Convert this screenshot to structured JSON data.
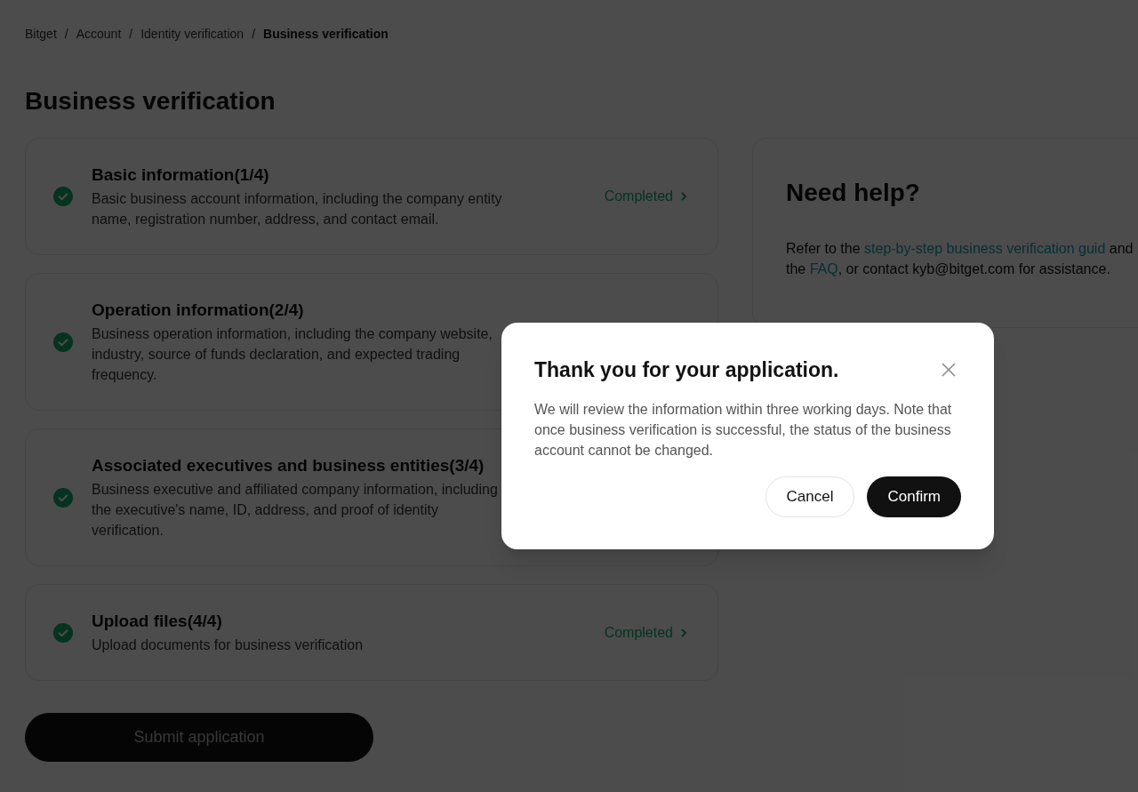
{
  "breadcrumb": [
    {
      "label": "Bitget",
      "current": false
    },
    {
      "label": "Account",
      "current": false
    },
    {
      "label": "Identity verification",
      "current": false
    },
    {
      "label": "Business verification",
      "current": true
    }
  ],
  "breadcrumb_separator": "/",
  "title": "Business verification",
  "steps": [
    {
      "title": "Basic information(1/4)",
      "description": "Basic business account information, including the company entity name, registration number, address, and contact email.",
      "completed": true,
      "status": "Completed"
    },
    {
      "title": "Operation information(2/4)",
      "description": "Business operation information, including the company website, industry, source of funds declaration, and expected trading frequency.",
      "completed": true
    },
    {
      "title": "Associated executives and business entities(3/4)",
      "description": "Business executive and affiliated company information, including the executive's name, ID, address, and proof of identity verification.",
      "completed": true
    },
    {
      "title": "Upload files(4/4)",
      "description": "Upload documents for business verification",
      "completed": true,
      "status": "Completed"
    }
  ],
  "submit_button": "Submit application",
  "help": {
    "title": "Need help?",
    "text": [
      {
        "kind": "text",
        "text": "Refer to the "
      },
      {
        "kind": "link",
        "text": "step-by-step business verification guid"
      },
      {
        "kind": "text",
        "text": " and the "
      },
      {
        "kind": "link",
        "text": "FAQ"
      },
      {
        "kind": "text",
        "text": ", or contact kyb@bitget.com for assistance."
      }
    ]
  },
  "dialog": {
    "title": "Thank you for your application.",
    "body": "We will review the information within three working days. Note that once business verification is successful, the status of the business account cannot be changed.",
    "buttons": [
      {
        "label": "Cancel",
        "kind": "secondary"
      },
      {
        "label": "Confirm",
        "kind": "primary"
      }
    ]
  }
}
